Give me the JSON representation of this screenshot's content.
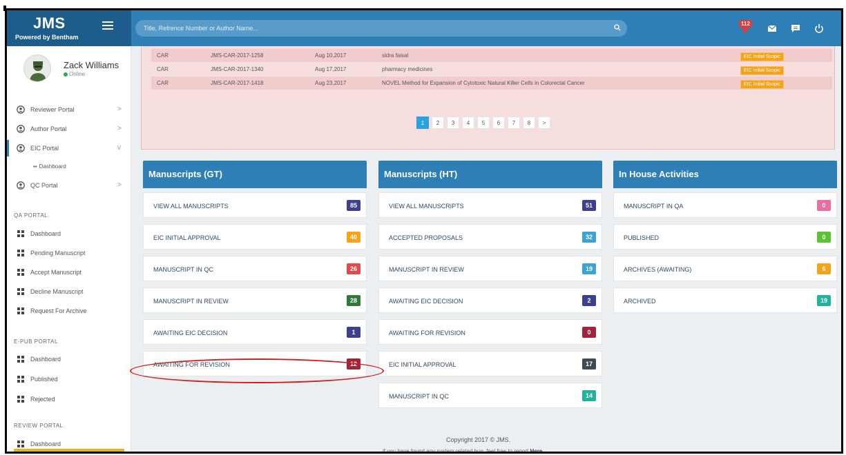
{
  "header": {
    "brand_title": "JMS",
    "brand_subtitle": "Powered by Bentham",
    "search_placeholder": "Title, Refrence Number or Author Name...",
    "notification_count": "112",
    "icons": [
      "menu-icon",
      "search-icon",
      "bell-icon",
      "mail-icon",
      "chat-icon",
      "power-icon"
    ]
  },
  "user": {
    "name": "Zack Williams",
    "status": "Online"
  },
  "sidebar": {
    "portals": [
      {
        "label": "Reviewer Portal",
        "chevron": ">"
      },
      {
        "label": "Author Portal",
        "chevron": ">"
      },
      {
        "label": "EIC Portal",
        "chevron": "v"
      },
      {
        "label": "QC Portal",
        "chevron": ">"
      }
    ],
    "eic_sub": "Dashboard",
    "qa_section": "QA PORTAL",
    "qa_items": [
      "Dashboard",
      "Pending Manuscript",
      "Accept Manuscript",
      "Decline Manuscript",
      "Request For Archive"
    ],
    "epub_section": "E-PUB PORTAL",
    "epub_items": [
      "Dashboard",
      "Published",
      "Rejected"
    ],
    "review_section": "REVIEW PORTAL",
    "review_items": [
      "Dashboard"
    ]
  },
  "table": {
    "rows": [
      {
        "journal": "CAR",
        "ref": "JMS-CAR-2017-1258",
        "date": "Aug 10,2017",
        "title": "sidra faisal",
        "status": "EIC Initial Scopic"
      },
      {
        "journal": "CAR",
        "ref": "JMS-CAR-2017-1340",
        "date": "Aug 17,2017",
        "title": "pharmacy medicines",
        "status": "EIC Initial Scopic"
      },
      {
        "journal": "CAR",
        "ref": "JMS-CAR-2017-1418",
        "date": "Aug 23,2017",
        "title": "NOVEL Method for Expansion of Cytotoxic Natural Killer Cells in Colorectal Cancer",
        "status": "EIC Initial Scopic"
      }
    ],
    "pages": [
      "1",
      "2",
      "3",
      "4",
      "5",
      "6",
      "7",
      "8",
      ">"
    ],
    "active_page": "1"
  },
  "panels": {
    "gt": {
      "title": "Manuscripts (GT)",
      "items": [
        {
          "label": "VIEW ALL MANUSCRIPTS",
          "count": "85",
          "color": "#3d3f8f"
        },
        {
          "label": "EIC INITIAL APPROVAL",
          "count": "40",
          "color": "#f5a31a"
        },
        {
          "label": "MANUSCRIPT IN QC",
          "count": "26",
          "color": "#e04b4b"
        },
        {
          "label": "MANUSCRIPT IN REVIEW",
          "count": "28",
          "color": "#2f7a3a"
        },
        {
          "label": "AWAITING EIC DECISION",
          "count": "1",
          "color": "#3d3f8f"
        },
        {
          "label": "AWAITING FOR REVISION",
          "count": "12",
          "color": "#a3243a"
        }
      ]
    },
    "ht": {
      "title": "Manuscripts (HT)",
      "items": [
        {
          "label": "VIEW ALL MANUSCRIPTS",
          "count": "51",
          "color": "#3d3f8f"
        },
        {
          "label": "ACCEPTED PROPOSALS",
          "count": "32",
          "color": "#3aa4d6"
        },
        {
          "label": "MANUSCRIPT IN REVIEW",
          "count": "19",
          "color": "#3aa4d6"
        },
        {
          "label": "AWAITING EIC DECISION",
          "count": "2",
          "color": "#3d3f8f"
        },
        {
          "label": "AWAITING FOR REVISION",
          "count": "0",
          "color": "#a3243a"
        },
        {
          "label": "EIC INITIAL APPROVAL",
          "count": "17",
          "color": "#3e4a56"
        },
        {
          "label": "MANUSCRIPT IN QC",
          "count": "14",
          "color": "#21b39b"
        }
      ]
    },
    "inhouse": {
      "title": "In House Activities",
      "items": [
        {
          "label": "MANUSCRIPT IN QA",
          "count": "0",
          "color": "#ea6ea0"
        },
        {
          "label": "PUBLISHED",
          "count": "0",
          "color": "#5bc236"
        },
        {
          "label": "ARCHIVES (AWAITING)",
          "count": "6",
          "color": "#f5a31a"
        },
        {
          "label": "ARCHIVED",
          "count": "19",
          "color": "#21b39b"
        }
      ]
    }
  },
  "footer": {
    "copyright": "Copyright 2017 © JMS.",
    "bug_text": "if you have found any system related bug, feel free to report ",
    "bug_link": "Here..."
  }
}
